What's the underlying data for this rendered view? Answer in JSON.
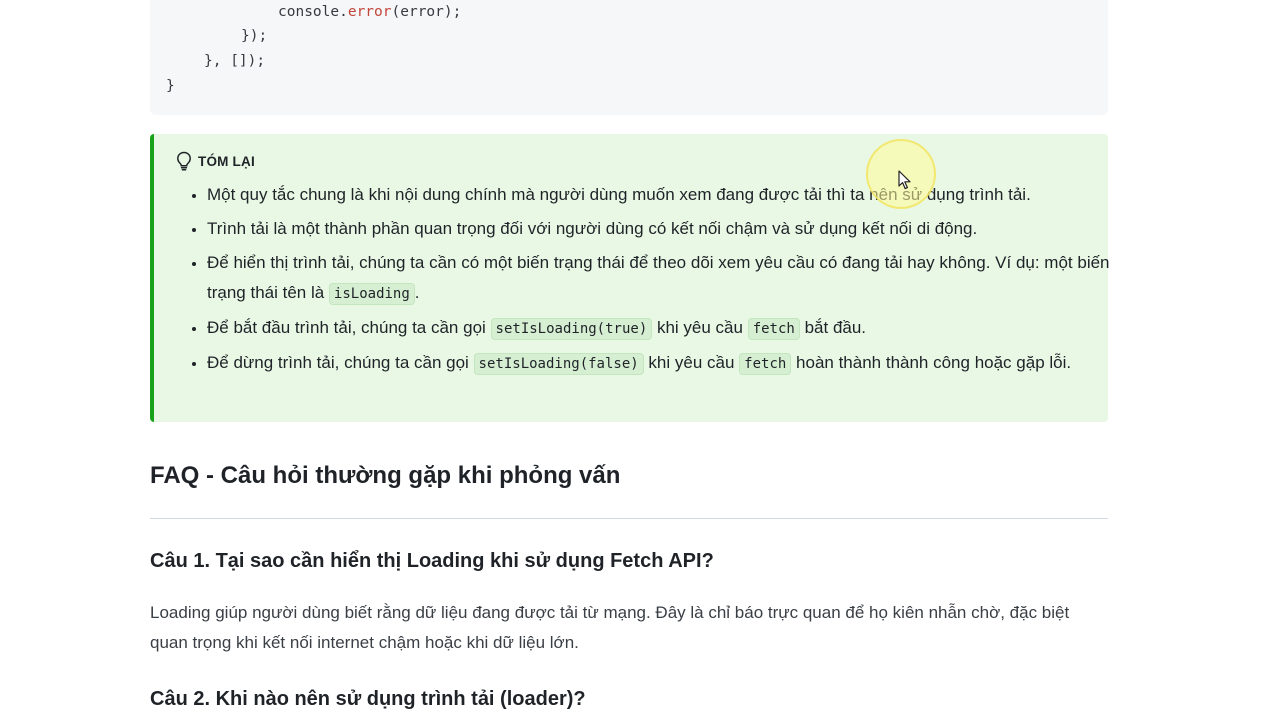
{
  "code": {
    "line1_prefix": "console.",
    "line1_fn": "error",
    "line1_suffix": "(error);",
    "line2": "});",
    "line3": "}, []);",
    "line4": "}"
  },
  "tip": {
    "title": "TÓM LẠI",
    "icon": "lightbulb-icon",
    "items": [
      {
        "text": "Một quy tắc chung là khi nội dung chính mà người dùng muốn xem đang được tải thì ta nên sử dụng trình tải."
      },
      {
        "text": "Trình tải là một thành phần quan trọng đối với người dùng có kết nối chậm và sử dụng kết nối di động."
      },
      {
        "text_a": "Để hiển thị trình tải, chúng ta cần có một biến trạng thái để theo dõi xem yêu cầu có đang tải hay không. Ví dụ: một biến trạng thái tên là ",
        "code_a": "isLoading",
        "text_b": "."
      },
      {
        "text_a": "Để bắt đầu trình tải, chúng ta cần gọi ",
        "code_a": "setIsLoading(true)",
        "text_b": " khi yêu cầu ",
        "code_b": "fetch",
        "text_c": " bắt đầu."
      },
      {
        "text_a": "Để dừng trình tải, chúng ta cần gọi ",
        "code_a": "setIsLoading(false)",
        "text_b": " khi yêu cầu ",
        "code_b": "fetch",
        "text_c": " hoàn thành thành công hoặc gặp lỗi."
      }
    ]
  },
  "faq": {
    "heading": "FAQ - Câu hỏi thường gặp khi phỏng vấn",
    "q1": "Câu 1. Tại sao cần hiển thị Loading khi sử dụng Fetch API?",
    "a1": "Loading giúp người dùng biết rằng dữ liệu đang được tải từ mạng. Đây là chỉ báo trực quan để họ kiên nhẫn chờ, đặc biệt quan trọng khi kết nối internet chậm hoặc khi dữ liệu lớn.",
    "q2": "Câu 2. Khi nào nên sử dụng trình tải (loader)?"
  },
  "colors": {
    "tip_bg": "#e8f8e5",
    "tip_border": "#1aa11a",
    "code_fn": "#c4453c"
  }
}
